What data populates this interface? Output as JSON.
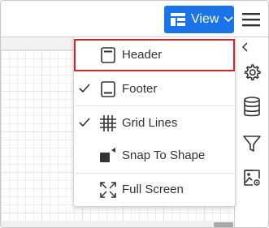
{
  "toolbar": {
    "view_button_label": "View",
    "view_icon": "layout-icon",
    "chevron_icon": "chevron-down-icon",
    "menu_icon": "hamburger-icon"
  },
  "view_menu": {
    "items": [
      {
        "label": "Header",
        "icon": "header-icon",
        "checked": false,
        "highlighted": true
      },
      {
        "label": "Footer",
        "icon": "footer-icon",
        "checked": true,
        "highlighted": false
      },
      {
        "label": "Grid Lines",
        "icon": "grid-lines-icon",
        "checked": true,
        "highlighted": false
      },
      {
        "label": "Snap To Shape",
        "icon": "snap-to-shape-icon",
        "checked": false,
        "highlighted": false
      },
      {
        "label": "Full Screen",
        "icon": "full-screen-icon",
        "checked": false,
        "highlighted": false
      }
    ],
    "check_glyph": "✓"
  },
  "side_panel": {
    "collapse_icon": "chevron-left-icon",
    "buttons": [
      "settings-icon",
      "database-icon",
      "filter-icon",
      "image-settings-icon"
    ]
  },
  "colors": {
    "accent": "#1a73e8",
    "highlight_border": "#d3262c",
    "text": "#333333",
    "icon": "#333333"
  }
}
